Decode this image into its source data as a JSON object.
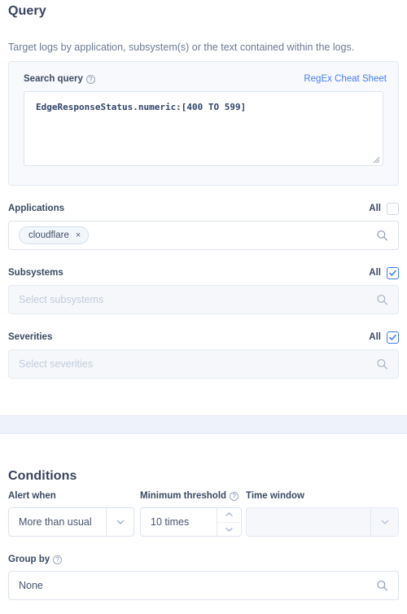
{
  "query_section": {
    "title": "Query",
    "description": "Target logs by application, subsystem(s) or the text contained within the logs.",
    "search_query": {
      "label": "Search query",
      "info_icon": "info-icon",
      "cheat_sheet_link": "RegEx Cheat Sheet",
      "value": "EdgeResponseStatus.numeric:[400 TO 599]",
      "placeholder": ""
    },
    "applications": {
      "label": "Applications",
      "all_label": "All",
      "all_checked": false,
      "chips": [
        "cloudflare"
      ],
      "chip_remove_icon": "×",
      "placeholder": "",
      "search_icon": "search-icon",
      "disabled": false
    },
    "subsystems": {
      "label": "Subsystems",
      "all_label": "All",
      "all_checked": true,
      "chips": [],
      "placeholder": "Select subsystems",
      "search_icon": "search-icon",
      "disabled": true
    },
    "severities": {
      "label": "Severities",
      "all_label": "All",
      "all_checked": true,
      "chips": [],
      "placeholder": "Select severities",
      "search_icon": "search-icon",
      "disabled": true
    }
  },
  "conditions_section": {
    "title": "Conditions",
    "alert_when": {
      "label": "Alert when",
      "value": "More than usual",
      "chevron_icon": "chevron-down-icon"
    },
    "minimum_threshold": {
      "label": "Minimum threshold",
      "info_icon": "info-icon",
      "value": "10 times",
      "up_icon": "chevron-up-icon",
      "down_icon": "chevron-down-icon"
    },
    "time_window": {
      "label": "Time window",
      "value": "",
      "chevron_icon": "chevron-down-icon",
      "disabled": true
    },
    "group_by": {
      "label": "Group by",
      "info_icon": "info-icon",
      "value": "None",
      "search_icon": "search-icon"
    }
  },
  "colors": {
    "accent_blue": "#3b7ef0",
    "link_blue": "#4a7df5",
    "heading": "#36435c",
    "band": "#eef2fa",
    "card_bg": "#f7f9fc"
  }
}
